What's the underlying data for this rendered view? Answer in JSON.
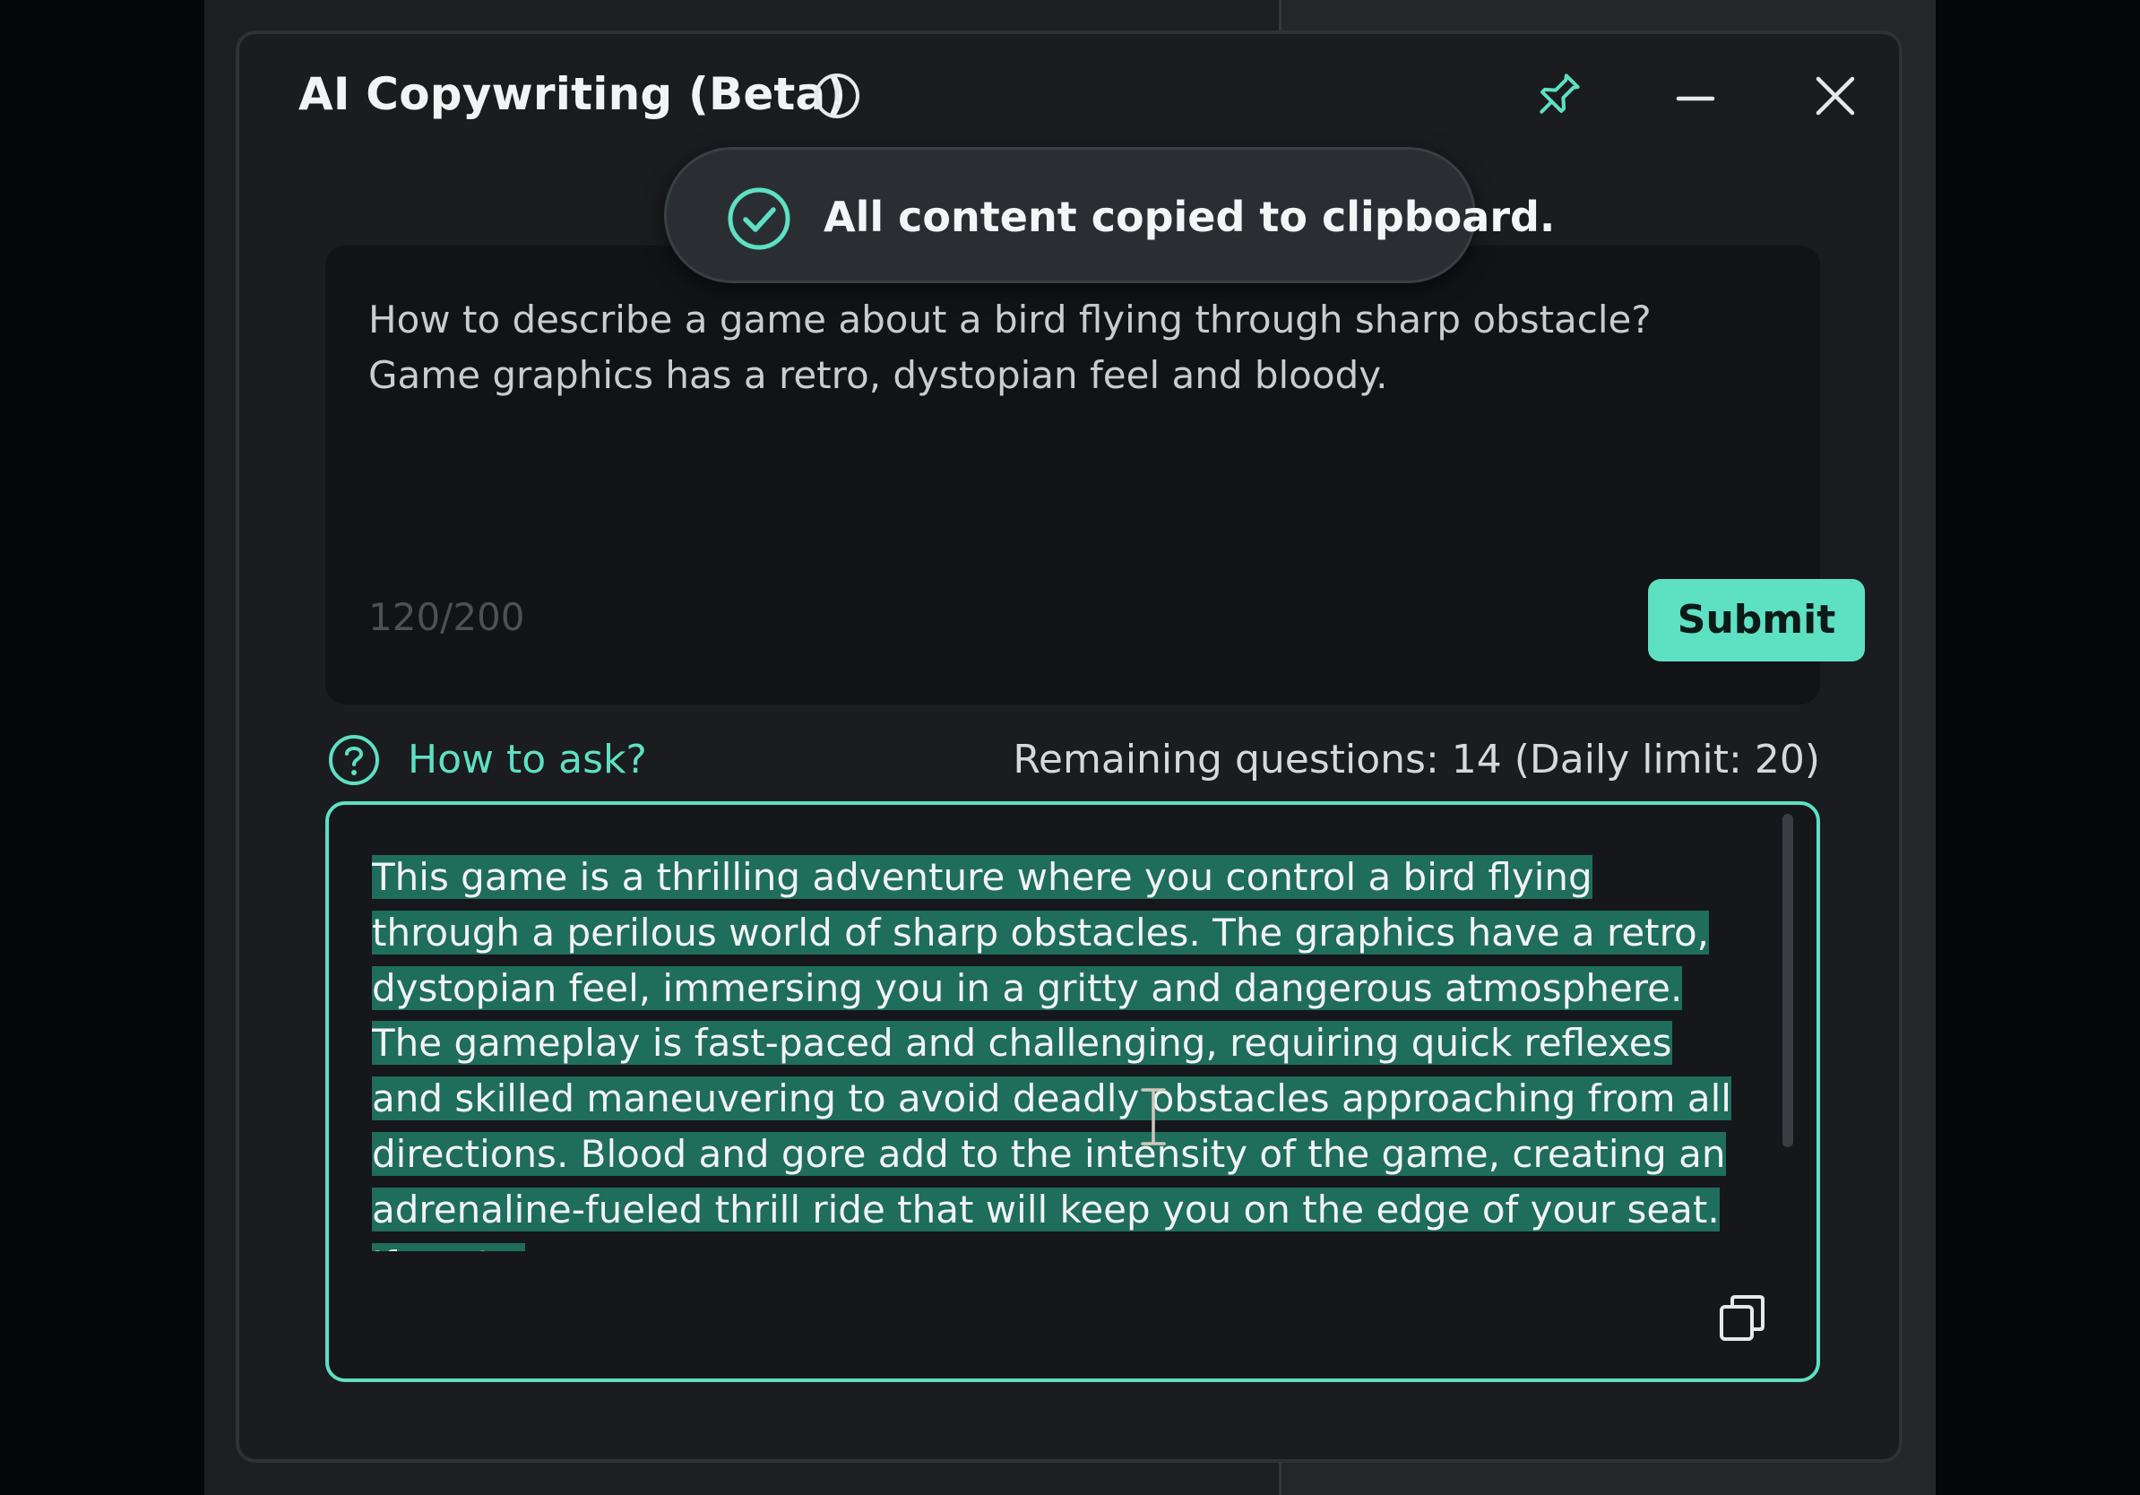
{
  "window": {
    "title": "AI Copywriting (Beta)"
  },
  "toast": {
    "message": "All content copied to clipboard."
  },
  "input": {
    "question": "How to describe a game about a bird flying through sharp obstacle? Game graphics has a retro, dystopian feel and bloody.",
    "counter": "120/200",
    "submit_label": "Submit"
  },
  "help": {
    "link_label": "How to ask?",
    "remaining": "Remaining questions: 14 (Daily limit: 20)"
  },
  "answer": {
    "text": "This game is a thrilling adventure where you control a bird flying through a perilous world of sharp obstacles. The graphics have a retro, dystopian feel, immersing you in a gritty and dangerous atmosphere. The gameplay is fast-paced and challenging, requiring quick reflexes and skilled maneuvering to avoid deadly obstacles approaching from all directions. Blood and gore add to the intensity of the game, creating an adrenaline-fueled thrill ride that will keep you on the edge of your seat. If you're"
  },
  "colors": {
    "accent": "#5ee0c2",
    "selection": "#1f6d5b",
    "panel": "#1a1c1f"
  },
  "icons": {
    "info": "info-icon",
    "pin": "pin-icon",
    "minimize": "minimize-icon",
    "close": "close-icon",
    "success": "check-circle-icon",
    "help": "question-circle-icon",
    "copy": "copy-icon"
  }
}
